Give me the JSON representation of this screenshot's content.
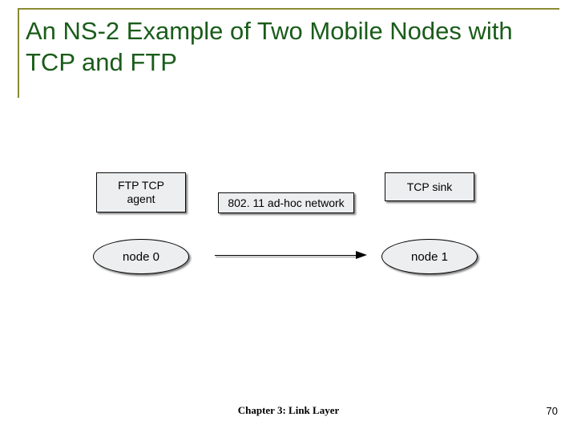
{
  "title": "An NS-2 Example of Two Mobile Nodes with TCP and FTP",
  "diagram": {
    "ftp_agent": "FTP TCP\nagent",
    "network": "802. 11 ad-hoc network",
    "sink": "TCP sink",
    "node0": "node 0",
    "node1": "node 1"
  },
  "footer": {
    "center": "Chapter 3: Link Layer",
    "page": "70"
  }
}
